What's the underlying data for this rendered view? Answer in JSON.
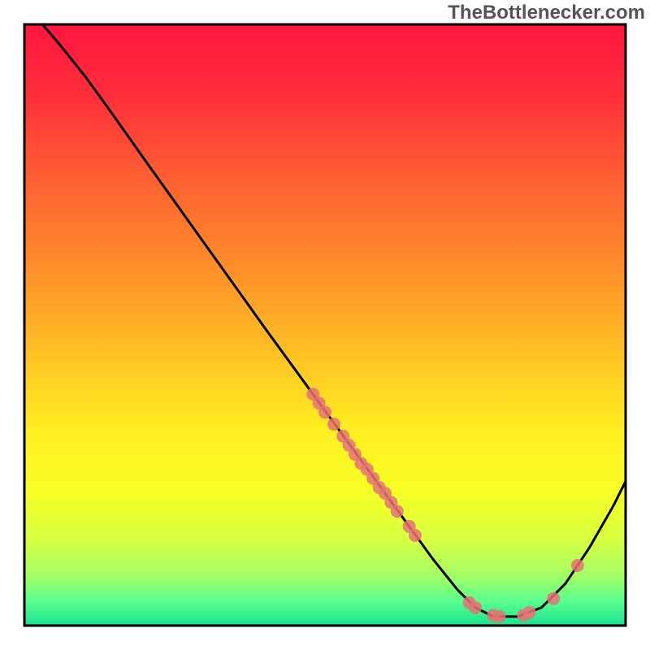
{
  "watermark": "TheBottlenecker.com",
  "chart_data": {
    "type": "line",
    "title": "",
    "xlabel": "",
    "ylabel": "",
    "xlim": [
      0,
      100
    ],
    "ylim": [
      0,
      100
    ],
    "background_gradient_stops": [
      {
        "offset": 0.0,
        "color": "#ff163f"
      },
      {
        "offset": 0.12,
        "color": "#ff2f3a"
      },
      {
        "offset": 0.25,
        "color": "#ff5d33"
      },
      {
        "offset": 0.4,
        "color": "#ff8c2a"
      },
      {
        "offset": 0.55,
        "color": "#ffc224"
      },
      {
        "offset": 0.68,
        "color": "#fff021"
      },
      {
        "offset": 0.78,
        "color": "#f7ff26"
      },
      {
        "offset": 0.86,
        "color": "#d6ff42"
      },
      {
        "offset": 0.92,
        "color": "#a0ff68"
      },
      {
        "offset": 0.96,
        "color": "#59ff8e"
      },
      {
        "offset": 1.0,
        "color": "#16e38f"
      }
    ],
    "series": [
      {
        "name": "bottleneck-curve",
        "color": "#000000",
        "points": [
          {
            "x": 3.0,
            "y": 100.0
          },
          {
            "x": 6.0,
            "y": 96.5
          },
          {
            "x": 10.0,
            "y": 91.5
          },
          {
            "x": 14.0,
            "y": 86.0
          },
          {
            "x": 20.0,
            "y": 77.5
          },
          {
            "x": 30.0,
            "y": 63.5
          },
          {
            "x": 40.0,
            "y": 49.5
          },
          {
            "x": 48.0,
            "y": 38.5
          },
          {
            "x": 52.0,
            "y": 33.0
          },
          {
            "x": 56.0,
            "y": 27.5
          },
          {
            "x": 60.0,
            "y": 22.0
          },
          {
            "x": 64.0,
            "y": 16.5
          },
          {
            "x": 68.0,
            "y": 11.0
          },
          {
            "x": 72.0,
            "y": 6.0
          },
          {
            "x": 75.0,
            "y": 3.0
          },
          {
            "x": 78.0,
            "y": 1.5
          },
          {
            "x": 82.0,
            "y": 1.5
          },
          {
            "x": 86.0,
            "y": 3.0
          },
          {
            "x": 90.0,
            "y": 7.0
          },
          {
            "x": 94.0,
            "y": 13.0
          },
          {
            "x": 98.0,
            "y": 20.0
          },
          {
            "x": 100.0,
            "y": 24.0
          }
        ]
      }
    ],
    "scatter": [
      {
        "name": "data-points",
        "color": "#e57373",
        "radius": 8,
        "points": [
          {
            "x": 48.0,
            "y": 38.5
          },
          {
            "x": 49.0,
            "y": 37.0
          },
          {
            "x": 50.0,
            "y": 35.5
          },
          {
            "x": 51.5,
            "y": 33.5
          },
          {
            "x": 53.0,
            "y": 31.5
          },
          {
            "x": 54.0,
            "y": 30.0
          },
          {
            "x": 55.0,
            "y": 28.5
          },
          {
            "x": 56.0,
            "y": 27.0
          },
          {
            "x": 57.0,
            "y": 26.0
          },
          {
            "x": 58.0,
            "y": 24.5
          },
          {
            "x": 59.0,
            "y": 23.0
          },
          {
            "x": 60.0,
            "y": 22.0
          },
          {
            "x": 61.0,
            "y": 20.5
          },
          {
            "x": 62.0,
            "y": 19.0
          },
          {
            "x": 64.0,
            "y": 16.5
          },
          {
            "x": 65.0,
            "y": 15.0
          },
          {
            "x": 74.0,
            "y": 3.8
          },
          {
            "x": 75.0,
            "y": 3.0
          },
          {
            "x": 78.0,
            "y": 1.7
          },
          {
            "x": 79.0,
            "y": 1.5
          },
          {
            "x": 83.0,
            "y": 1.7
          },
          {
            "x": 84.0,
            "y": 2.2
          },
          {
            "x": 88.0,
            "y": 4.5
          },
          {
            "x": 92.0,
            "y": 10.0
          }
        ]
      }
    ]
  }
}
